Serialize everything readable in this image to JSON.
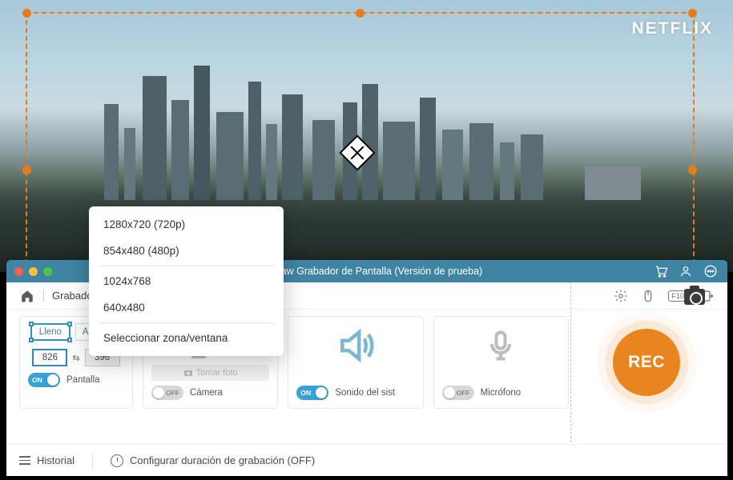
{
  "watermark": "NETFLIX",
  "title": "FonePaw Grabador de Pantalla (Versión de prueba)",
  "breadcrumb": "Grabador de vídeo",
  "hotkey_badge": "F10",
  "dimension_panel": {
    "btn_full": "Lleno",
    "btn_fit": "Adaptar",
    "width": "826",
    "height": "396",
    "toggle_state": "ON",
    "label": "Pantalla"
  },
  "camera_panel": {
    "photo_btn": "Tomar foto",
    "toggle_state": "OFF",
    "label": "Cámera"
  },
  "sound_panel": {
    "toggle_state": "ON",
    "label": "Sonido del sist"
  },
  "mic_panel": {
    "toggle_state": "OFF",
    "label": "Micrófono"
  },
  "rec_label": "REC",
  "footer": {
    "history": "Historial",
    "duration": "Configurar duración de grabación (OFF)"
  },
  "resolution_menu": {
    "items": [
      "1280x720 (720p)",
      "854x480 (480p)",
      "1024x768",
      "640x480",
      "Seleccionar zona/ventana"
    ]
  }
}
